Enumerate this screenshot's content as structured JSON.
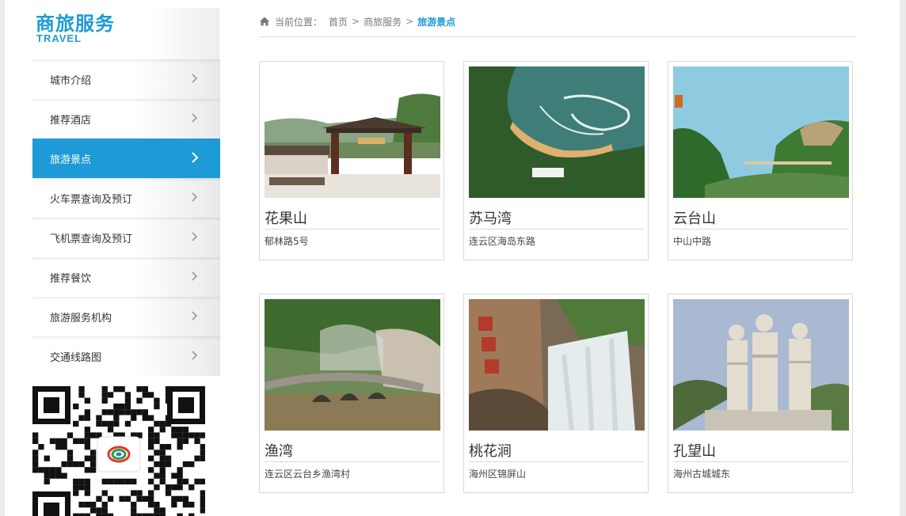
{
  "sidebar": {
    "title": "商旅服务",
    "subtitle": "TRAVEL",
    "items": [
      {
        "label": "城市介绍"
      },
      {
        "label": "推荐酒店"
      },
      {
        "label": "旅游景点"
      },
      {
        "label": "火车票查询及预订"
      },
      {
        "label": "飞机票查询及预订"
      },
      {
        "label": "推荐餐饮"
      },
      {
        "label": "旅游服务机构"
      },
      {
        "label": "交通线路图"
      }
    ],
    "active_index": 2
  },
  "breadcrumb": {
    "prefix": "当前位置：",
    "home": "首页",
    "parent": "商旅服务",
    "current": "旅游景点",
    "separator": ">"
  },
  "attractions": [
    {
      "name": "花果山",
      "address": "郁林路5号"
    },
    {
      "name": "苏马湾",
      "address": "连云区海岛东路"
    },
    {
      "name": "云台山",
      "address": "中山中路"
    },
    {
      "name": "渔湾",
      "address": "连云区云台乡渔湾村"
    },
    {
      "name": "桃花涧",
      "address": "海州区锦屏山"
    },
    {
      "name": "孔望山",
      "address": "海州古城城东"
    }
  ],
  "colors": {
    "accent": "#1e9ad6",
    "border": "#d9d9d9"
  }
}
